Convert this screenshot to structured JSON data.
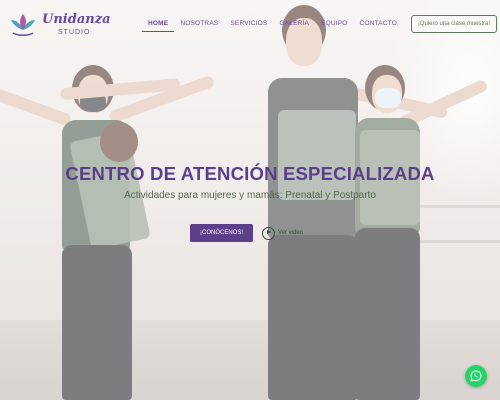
{
  "brand": {
    "name": "Unidanza",
    "subtitle": "STUDIO",
    "colors": {
      "primary": "#5b3f8a",
      "green": "#4f6c48",
      "whatsapp": "#25d366"
    }
  },
  "nav": {
    "items": [
      {
        "label": "HOME",
        "active": true
      },
      {
        "label": "NOSOTRAS",
        "active": false
      },
      {
        "label": "SERVICIOS",
        "active": false
      },
      {
        "label": "GALERÍA",
        "active": false
      },
      {
        "label": "EQUIPO",
        "active": false
      },
      {
        "label": "CONTACTO",
        "active": false
      }
    ],
    "cta_label": "¡Quiero una clase muestra!"
  },
  "hero": {
    "title": "CENTRO DE ATENCIÓN ESPECIALIZADA",
    "subtitle": "Actividades para mujeres y mamás: Prenatal y Postparto",
    "primary_button": "¡CONÓCENOS!",
    "video_link": "Ver video"
  },
  "floating": {
    "icon": "whatsapp-icon"
  }
}
